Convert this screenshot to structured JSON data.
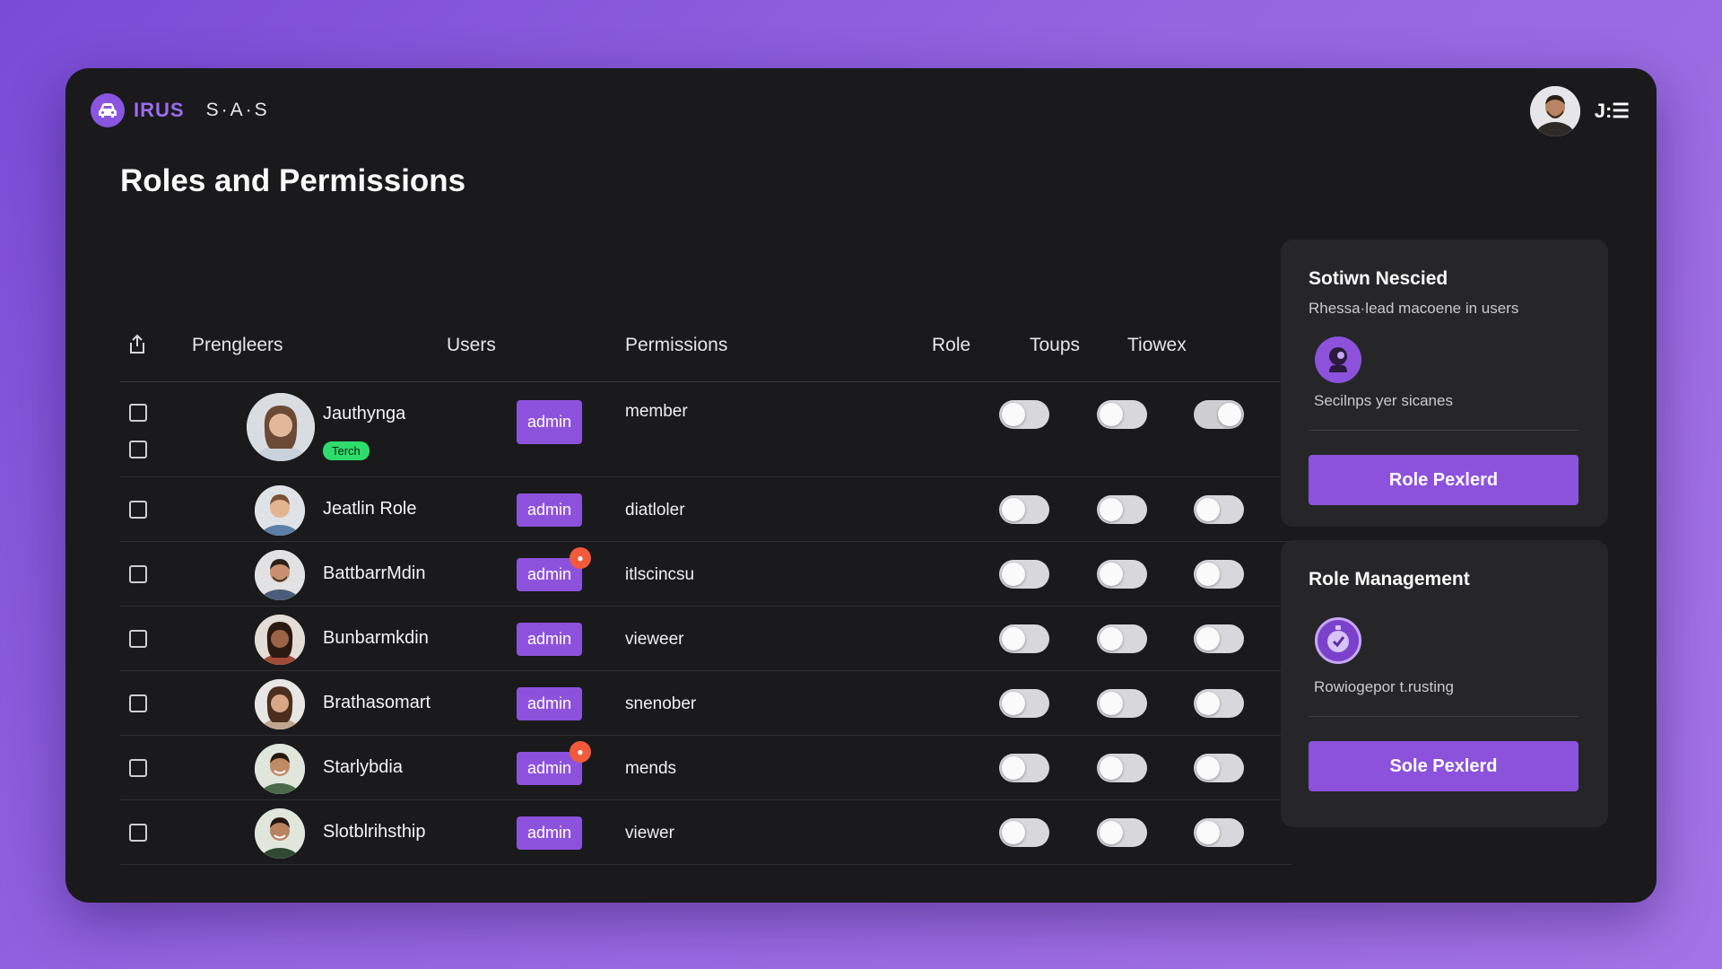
{
  "brand": {
    "name": "IRUS",
    "sub": "S·A·S"
  },
  "user": {
    "initials": "J:☰"
  },
  "page_title": "Roles and Permissions",
  "table": {
    "headers": [
      "Prengleers",
      "Users",
      "Permissions",
      "Role",
      "Toups",
      "Tiowex"
    ],
    "rows": [
      {
        "name": "Jauthynga",
        "tag": "Terch",
        "badge": "admin",
        "permission": "member",
        "toggles": [
          false,
          false,
          true
        ],
        "notify": false
      },
      {
        "name": "Jeatlin Role",
        "badge": "admin",
        "permission": "diatloler",
        "toggles": [
          false,
          false,
          false
        ],
        "notify": false
      },
      {
        "name": "BattbarrMdin",
        "badge": "admin",
        "permission": "itlscincsu",
        "toggles": [
          false,
          false,
          false
        ],
        "notify": true
      },
      {
        "name": "Bunbarmkdin",
        "badge": "admin",
        "permission": "vieweer",
        "toggles": [
          false,
          false,
          false
        ],
        "notify": false
      },
      {
        "name": "Brathasomart",
        "badge": "admin",
        "permission": "snenober",
        "toggles": [
          false,
          false,
          false
        ],
        "notify": false
      },
      {
        "name": "Starlybdia",
        "badge": "admin",
        "permission": "mends",
        "toggles": [
          false,
          false,
          false
        ],
        "notify": true
      },
      {
        "name": "Slotblrihsthip",
        "badge": "admin",
        "permission": "viewer",
        "toggles": [
          false,
          false,
          false
        ],
        "notify": false
      }
    ]
  },
  "card1": {
    "title": "Sotiwn Nescied",
    "subtitle": "Rhessa·lead macoene in users",
    "caption": "Secilnps yer sicanes",
    "button": "Role Pexlerd"
  },
  "card2": {
    "title": "Role Management",
    "caption": "Rowiogepor t.rusting",
    "button": "Sole Pexlerd"
  },
  "colors": {
    "accent": "#8d52dc",
    "tag": "#2ddc6a",
    "notify": "#f25a3c",
    "panel": "#1a1a1c"
  },
  "icons": [
    "car-logo-icon",
    "share-icon",
    "user-circle-icon",
    "clock-check-icon"
  ]
}
